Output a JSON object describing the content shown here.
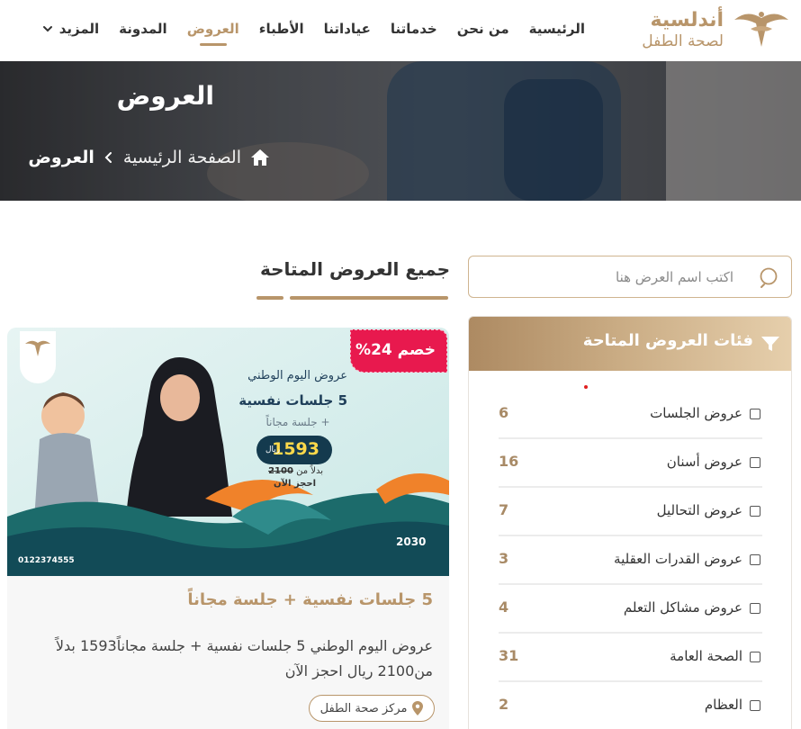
{
  "brand": {
    "name_line1": "أندلسية",
    "name_line2": "لصحة الطفل",
    "color": "#b8956a"
  },
  "nav": {
    "items": [
      {
        "label": "الرئيسية",
        "active": false
      },
      {
        "label": "من نحن",
        "active": false
      },
      {
        "label": "خدماتنا",
        "active": false
      },
      {
        "label": "عياداتنا",
        "active": false
      },
      {
        "label": "الأطباء",
        "active": false
      },
      {
        "label": "العروض",
        "active": true
      },
      {
        "label": "المدونة",
        "active": false
      }
    ],
    "more_label": "المزيد",
    "more_icon": "chevron-down-icon"
  },
  "hero": {
    "title": "العروض",
    "breadcrumb": {
      "home_icon": "home-icon",
      "home_label": "الصفحة الرئيسية",
      "separator_icon": "chevron-left-icon",
      "current": "العروض"
    }
  },
  "offers_section": {
    "title": "جميع العروض المتاحة"
  },
  "search": {
    "placeholder": "اكتب اسم العرض هنا",
    "value": "",
    "icon": "search-icon"
  },
  "categories": {
    "title": "فئات العروض المتاحة",
    "icon": "filter-icon",
    "items": [
      {
        "label": "عروض الجلسات",
        "count": "6",
        "checked": false
      },
      {
        "label": "عروض أسنان",
        "count": "16",
        "checked": false
      },
      {
        "label": "عروض التحاليل",
        "count": "7",
        "checked": false
      },
      {
        "label": "عروض القدرات العقلية",
        "count": "3",
        "checked": false
      },
      {
        "label": "عروض مشاكل التعلم",
        "count": "4",
        "checked": false
      },
      {
        "label": "الصحة العامة",
        "count": "31",
        "checked": false
      },
      {
        "label": "العظام",
        "count": "2",
        "checked": false
      }
    ]
  },
  "offer_card": {
    "discount_badge": "خصم 24%",
    "image": {
      "line1": "عروض اليوم الوطني",
      "line2": "5 جلسات نفسية",
      "line3": "+ جلسة مجاناً",
      "price": "1593",
      "currency": "ريال",
      "old_prefix": "بدلاً من",
      "old_price": "2100",
      "book_now": "احجز الآن",
      "phone": "0122374555",
      "vision": "2030"
    },
    "title": "5 جلسات نفسية + جلسة مجاناً",
    "description": "عروض اليوم الوطني 5 جلسات نفسية + جلسة مجاناً1593 بدلاً من2100 ريال احجز الآن",
    "location": "مركز صحة الطفل",
    "location_icon": "map-pin-icon"
  },
  "colors": {
    "gold": "#b8956a",
    "badge_red": "#e8194e",
    "promo_teal": "#1c6b6b",
    "promo_orange": "#f0822a"
  }
}
